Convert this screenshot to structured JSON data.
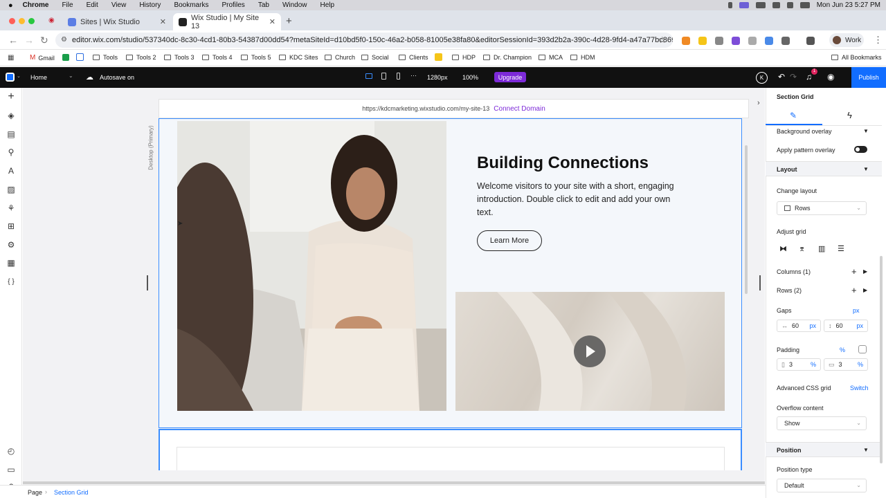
{
  "mac_menu": {
    "app": "Chrome",
    "items": [
      "File",
      "Edit",
      "View",
      "History",
      "Bookmarks",
      "Profiles",
      "Tab",
      "Window",
      "Help"
    ],
    "datetime": "Mon Jun 23  5:27 PM"
  },
  "tabs": [
    {
      "title": "Sites | Wix Studio",
      "active": false
    },
    {
      "title": "Wix Studio | My Site 13",
      "active": true
    }
  ],
  "address": {
    "url": "editor.wix.com/studio/537340dc-8c30-4cd1-80b3-54387d00dd54?metaSiteId=d10bd5f0-150c-46a2-b058-81005e38fa80&editorSessionId=393d2b2a-390c-4d28-9fd4-a47a77bc869f",
    "profile": "Work"
  },
  "bookmarks": {
    "items": [
      "Gmail",
      "Tools",
      "Tools 2",
      "Tools 3",
      "Tools 4",
      "Tools 5",
      "KDC Sites",
      "Church",
      "Social",
      "Clients",
      "HDP",
      "Dr. Champion",
      "MCA",
      "HDM"
    ],
    "all": "All Bookmarks"
  },
  "editor_bar": {
    "page": "Home",
    "autosave": "Autosave on",
    "breakpoint": "1280px",
    "zoom": "100%",
    "upgrade": "Upgrade",
    "avatar": "K",
    "notif_count": "1",
    "publish": "Publish",
    "more": "···"
  },
  "canvas": {
    "site_url": "https://kdcmarketing.wixstudio.com/my-site-13",
    "connect_domain": "Connect Domain",
    "desktop_label": "Desktop (Primary)"
  },
  "section": {
    "heading": "Building Connections",
    "paragraph": "Welcome visitors to your site with a short, engaging introduction. Double click to edit and add your own text.",
    "button": "Learn More"
  },
  "panel": {
    "title": "Section Grid",
    "background_overlay": "Background overlay",
    "pattern_overlay": "Apply pattern overlay",
    "layout_header": "Layout",
    "change_layout": "Change layout",
    "layout_value": "Rows",
    "adjust_grid": "Adjust grid",
    "columns": "Columns (1)",
    "rows": "Rows (2)",
    "gaps": "Gaps",
    "gaps_unit": "px",
    "gap_h": "60",
    "gap_v": "60",
    "unit_px": "px",
    "padding": "Padding",
    "padding_unit": "%",
    "pad_h": "3",
    "pad_v": "3",
    "unit_pct": "%",
    "advanced_css": "Advanced CSS grid",
    "switch": "Switch",
    "overflow": "Overflow content",
    "overflow_value": "Show",
    "position_header": "Position",
    "position_type": "Position type",
    "position_value": "Default"
  },
  "breadcrumb": {
    "page": "Page",
    "current": "Section Grid"
  },
  "colors": {
    "accent": "#116dff",
    "upgrade": "#7d2ad8",
    "selection": "#3a8dff"
  }
}
